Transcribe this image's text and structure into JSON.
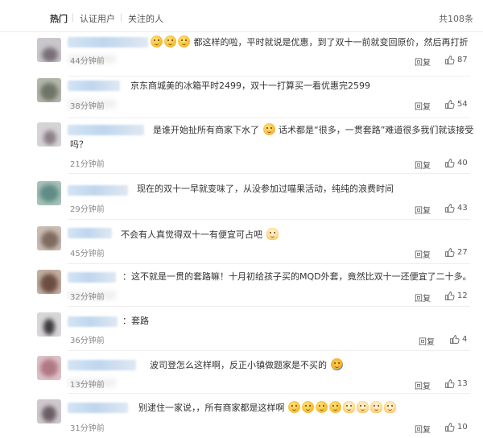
{
  "tabs": [
    {
      "label": "热门",
      "active": true
    },
    {
      "label": "认证用户",
      "active": false
    },
    {
      "label": "关注的人",
      "active": false
    }
  ],
  "total": "共108条",
  "reply_label": "回复",
  "comments": [
    {
      "text": "都这样的啦，平时就说是优惠，到了双十一前就变回原价，然后再打折",
      "time": "44分钟前",
      "likes": "87"
    },
    {
      "text": "京东商城美的冰箱平时2499，双十一打算买一看优惠完2599",
      "time": "38分钟前",
      "likes": "54"
    },
    {
      "text_a": "是谁开始扯所有商家下水了",
      "text_b": "话术都是“很多，一贯套路”难道很多我们就该接受",
      "text_c": "吗？",
      "time": "21分钟前",
      "likes": "40"
    },
    {
      "text": "现在的双十一早就变味了，从没参加过喵果活动，纯纯的浪费时间",
      "time": "29分钟前",
      "likes": "43"
    },
    {
      "text": "不会有人真觉得双十一有便宜可占吧",
      "time": "45分钟前",
      "likes": "27"
    },
    {
      "text": "：这不就是一贯的套路嘛！十月初给孩子买的MQD外套，竟然比双十一还便宜了二十多。",
      "time": "32分钟前",
      "likes": "12"
    },
    {
      "text": "：套路",
      "time": "36分钟前",
      "likes": "4"
    },
    {
      "text": "波司登怎么这样啊，反正小镇做题家是不买的",
      "time": "13分钟前",
      "likes": "13"
    },
    {
      "text": "别逮住一家说，，所有商家都是这样啊",
      "time": "31分钟前",
      "likes": "10"
    }
  ],
  "colors": {
    "text": "#333333",
    "muted": "#888888",
    "divider": "#eeeeee"
  },
  "icons": {
    "like": "thumbs-up-icon",
    "emoji": "emoji-icon"
  }
}
